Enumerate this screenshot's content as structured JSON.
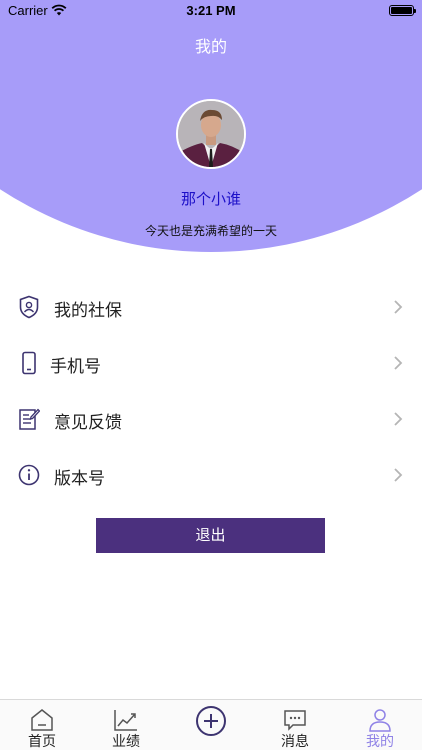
{
  "status_bar": {
    "carrier": "Carrier",
    "time": "3:21 PM"
  },
  "header": {
    "title": "我的"
  },
  "profile": {
    "name": "那个小谁",
    "motto": "今天也是充满希望的一天"
  },
  "menu": {
    "items": [
      {
        "label": "我的社保",
        "icon": "shield-person-icon"
      },
      {
        "label": "手机号",
        "icon": "phone-icon"
      },
      {
        "label": "意见反馈",
        "icon": "feedback-edit-icon"
      },
      {
        "label": "版本号",
        "icon": "info-circle-icon"
      }
    ]
  },
  "logout": {
    "label": "退出"
  },
  "tabbar": {
    "tabs": [
      {
        "label": "首页",
        "icon": "home-icon"
      },
      {
        "label": "业绩",
        "icon": "chart-line-icon"
      },
      {
        "label": "",
        "icon": "add-circle-icon"
      },
      {
        "label": "消息",
        "icon": "message-icon"
      },
      {
        "label": "我的",
        "icon": "person-icon",
        "active": true
      }
    ]
  },
  "colors": {
    "header_bg": "#a79cf9",
    "name": "#1d10c8",
    "button": "#4b307e",
    "active_tab": "#8f82e6"
  }
}
